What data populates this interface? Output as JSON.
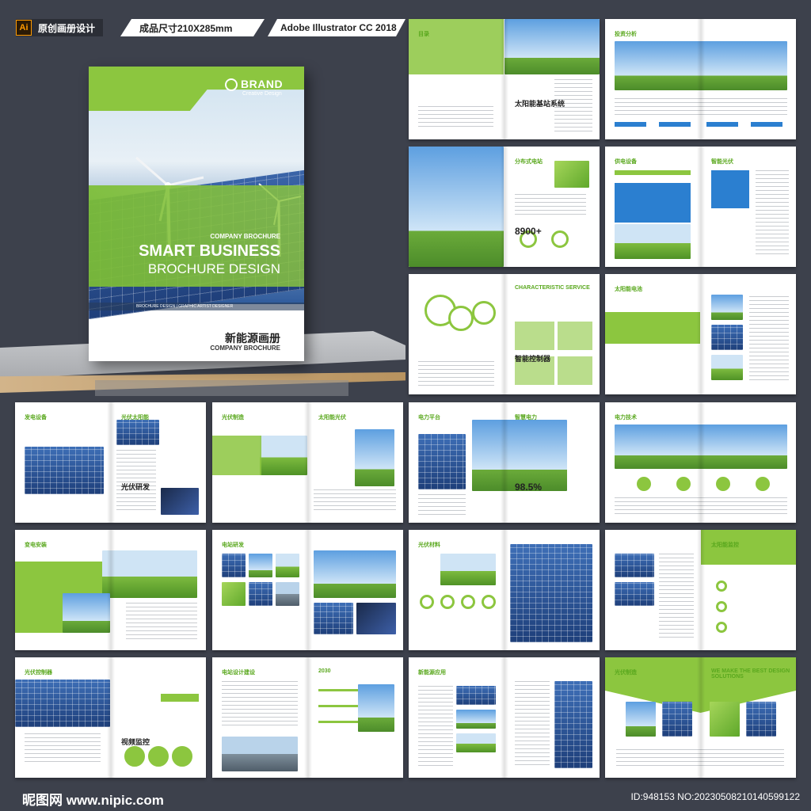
{
  "header": {
    "ai_badge": "Ai",
    "tag_original": "原创画册设计",
    "tag_size": "成品尺寸210X285mm",
    "tag_software": "Adobe Illustrator CC 2018"
  },
  "cover": {
    "brand_name": "BRAND",
    "brand_sub": "Creative Design",
    "company_brochure_small": "COMPANY BROCHURE",
    "title_line1": "SMART BUSINESS",
    "title_line2": "BROCHURE DESIGN",
    "strip_text": "BROCHURE DESIGN  |  GRAPHIC ARTIST DESIGNER",
    "title_cn": "新能源画册",
    "title_en": "COMPANY BROCHURE"
  },
  "spreads": [
    {
      "title_left": "目录",
      "title_right": "",
      "extra": "太阳能基站系统"
    },
    {
      "title_left": "投资分析",
      "title_right": "",
      "extra": ""
    },
    {
      "title_left": "",
      "title_right": "分布式电站",
      "extra": "8900+"
    },
    {
      "title_left": "供电设备",
      "title_right": "智能光伏",
      "extra": ""
    },
    {
      "title_left": "",
      "title_right": "CHARACTERISTIC SERVICE",
      "extra": "智能控制器"
    },
    {
      "title_left": "太阳能电池",
      "title_right": "",
      "extra": ""
    },
    {
      "title_left": "发电设备",
      "title_right": "光伏太阳能",
      "extra": "光伏研发"
    },
    {
      "title_left": "光伏制造",
      "title_right": "太阳能光伏",
      "extra": ""
    },
    {
      "title_left": "电力平台",
      "title_right": "智慧电力",
      "extra": "98.5%"
    },
    {
      "title_left": "电力技术",
      "title_right": "",
      "extra": ""
    },
    {
      "title_left": "变电安装",
      "title_right": "",
      "extra": ""
    },
    {
      "title_left": "电站研发",
      "title_right": "",
      "extra": ""
    },
    {
      "title_left": "光伏材料",
      "title_right": "",
      "extra": ""
    },
    {
      "title_left": "",
      "title_right": "太阳能监控",
      "extra": ""
    },
    {
      "title_left": "光伏控制器",
      "title_right": "",
      "extra": "视频监控"
    },
    {
      "title_left": "电站设计建设",
      "title_right": "2030",
      "extra": ""
    },
    {
      "title_left": "新能源应用",
      "title_right": "",
      "extra": ""
    },
    {
      "title_left": "光伏制造",
      "title_right": "WE MAKE THE BEST DESIGN SOLUTIONS",
      "extra": ""
    }
  ],
  "footer": {
    "logo": "昵图网 www.nipic.com",
    "id_text": "ID:948153 NO:20230508210140599122"
  },
  "colors": {
    "accent_green": "#8cc63f",
    "accent_blue": "#2b7fd0",
    "background": "#3d414c"
  }
}
